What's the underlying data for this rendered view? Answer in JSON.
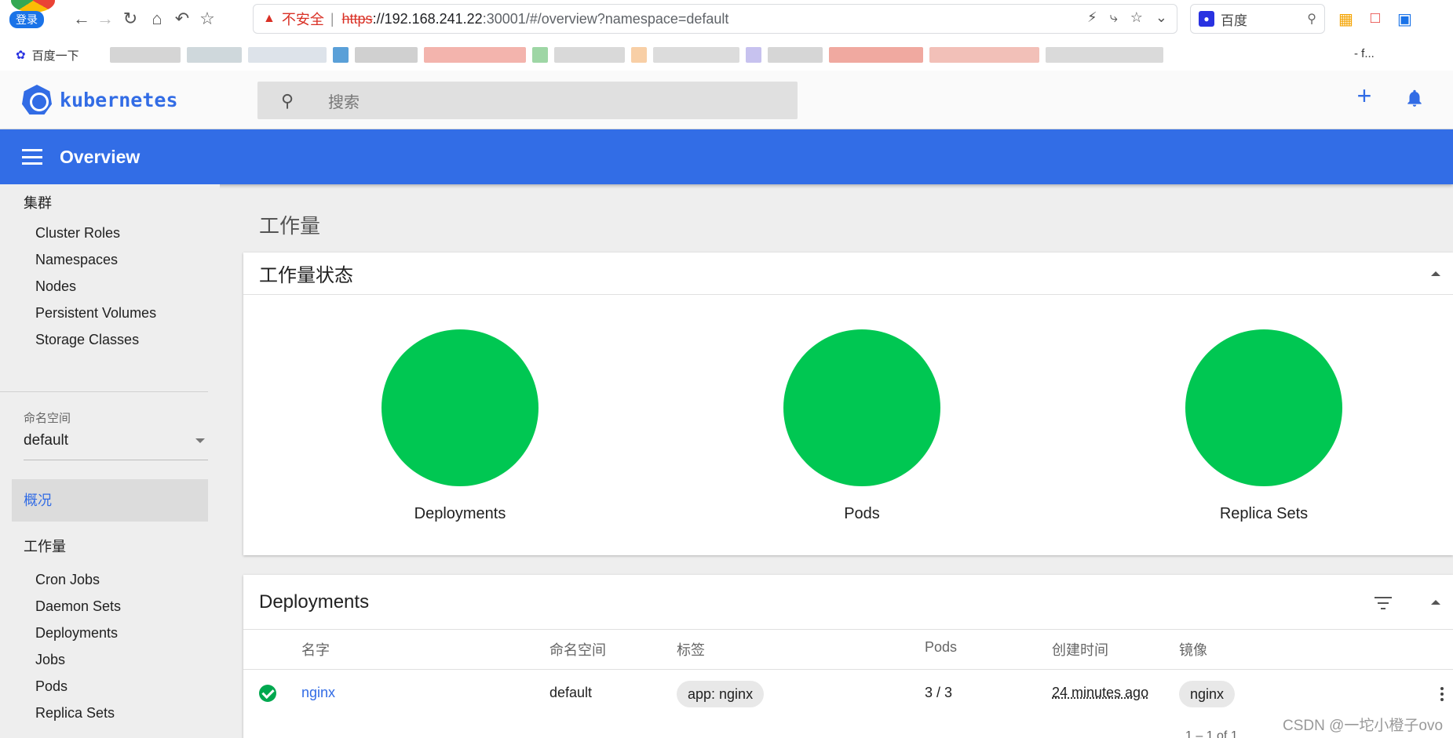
{
  "browser": {
    "login_label": "登录",
    "insecure_label": "不安全",
    "separator": "|",
    "url_scheme": "https",
    "url_host": "://192.168.241.22",
    "url_rest": ":30001/#/overview?namespace=default",
    "search_engine_label": "百度",
    "bookmark_first": "百度一下",
    "bookmark_more": "- f..."
  },
  "header": {
    "brand": "kubernetes",
    "search_placeholder": "搜索",
    "plus_label": "+"
  },
  "title_bar": {
    "title": "Overview"
  },
  "sidebar": {
    "cluster_section": "集群",
    "cluster_items": [
      "Cluster Roles",
      "Namespaces",
      "Nodes",
      "Persistent Volumes",
      "Storage Classes"
    ],
    "namespace_label": "命名空间",
    "namespace_value": "default",
    "active_item": "概况",
    "workloads_section": "工作量",
    "workload_items": [
      "Cron Jobs",
      "Daemon Sets",
      "Deployments",
      "Jobs",
      "Pods",
      "Replica Sets"
    ]
  },
  "main": {
    "heading": "工作量",
    "status_card": {
      "title": "工作量状态",
      "items": [
        {
          "label": "Deployments",
          "color": "#00c752"
        },
        {
          "label": "Pods",
          "color": "#00c752"
        },
        {
          "label": "Replica Sets",
          "color": "#00c752"
        }
      ]
    },
    "deployments_card": {
      "title": "Deployments",
      "columns": [
        "名字",
        "命名空间",
        "标签",
        "Pods",
        "创建时间",
        "镜像"
      ],
      "rows": [
        {
          "status": "running",
          "name": "nginx",
          "namespace": "default",
          "label": "app: nginx",
          "pods": "3 / 3",
          "created": "24 minutes ago",
          "image": "nginx"
        }
      ],
      "pager": "1 – 1 of 1"
    }
  },
  "watermark": "CSDN @一坨小橙子ovo",
  "colors": {
    "accent": "#326de6",
    "success": "#00c752"
  }
}
